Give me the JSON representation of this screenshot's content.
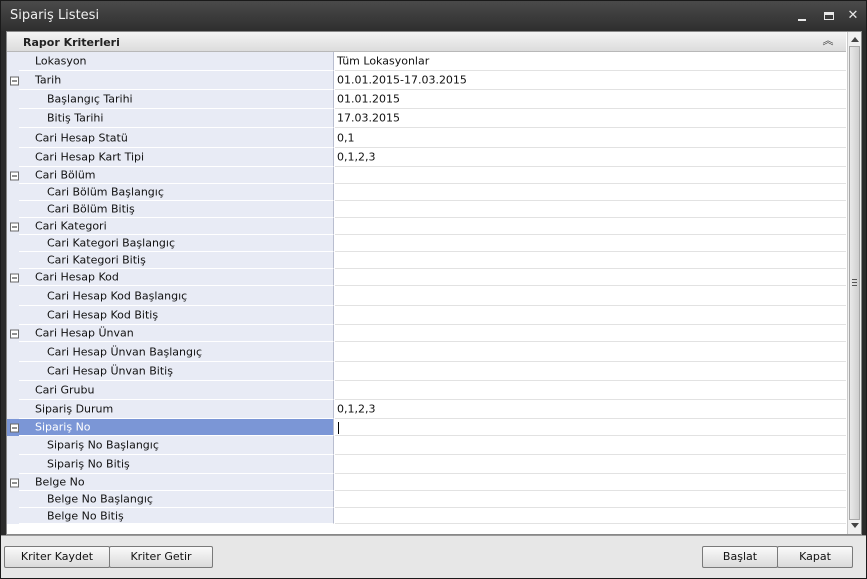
{
  "window": {
    "title": "Sipariş Listesi"
  },
  "group": {
    "title": "Rapor Kriterleri"
  },
  "rows": [
    {
      "name": "Lokasyon",
      "value": "Tüm Lokasyonlar",
      "level": 0,
      "expander": false
    },
    {
      "name": "Tarih",
      "value": "01.01.2015-17.03.2015",
      "level": 0,
      "expander": true
    },
    {
      "name": "Başlangıç Tarihi",
      "value": "01.01.2015",
      "level": 1,
      "expander": false
    },
    {
      "name": "Bitiş Tarihi",
      "value": "17.03.2015",
      "level": 1,
      "expander": false
    },
    {
      "name": "Cari Hesap Statü",
      "value": "0,1",
      "level": 0,
      "expander": false
    },
    {
      "name": "Cari Hesap Kart Tipi",
      "value": "0,1,2,3",
      "level": 0,
      "expander": false
    },
    {
      "name": "Cari Bölüm",
      "value": "",
      "level": 0,
      "expander": true
    },
    {
      "name": "Cari Bölüm Başlangıç",
      "value": "",
      "level": 1,
      "expander": false
    },
    {
      "name": "Cari Bölüm Bitiş",
      "value": "",
      "level": 1,
      "expander": false
    },
    {
      "name": "Cari Kategori",
      "value": "",
      "level": 0,
      "expander": true
    },
    {
      "name": "Cari Kategori Başlangıç",
      "value": "",
      "level": 1,
      "expander": false
    },
    {
      "name": "Cari Kategori Bitiş",
      "value": "",
      "level": 1,
      "expander": false
    },
    {
      "name": "Cari Hesap Kod",
      "value": "",
      "level": 0,
      "expander": true
    },
    {
      "name": "Cari Hesap Kod Başlangıç",
      "value": "",
      "level": 1,
      "expander": false
    },
    {
      "name": "Cari Hesap Kod Bitiş",
      "value": "",
      "level": 1,
      "expander": false
    },
    {
      "name": "Cari Hesap Ünvan",
      "value": "",
      "level": 0,
      "expander": true
    },
    {
      "name": "Cari Hesap Ünvan Başlangıç",
      "value": "",
      "level": 1,
      "expander": false
    },
    {
      "name": "Cari Hesap Ünvan Bitiş",
      "value": "",
      "level": 1,
      "expander": false
    },
    {
      "name": "Cari Grubu",
      "value": "",
      "level": 0,
      "expander": false
    },
    {
      "name": "Sipariş Durum",
      "value": "0,1,2,3",
      "level": 0,
      "expander": false
    },
    {
      "name": "Sipariş No",
      "value": "",
      "level": 0,
      "expander": true,
      "selected": true
    },
    {
      "name": "Sipariş No Başlangıç",
      "value": "",
      "level": 1,
      "expander": false
    },
    {
      "name": "Sipariş No Bitiş",
      "value": "",
      "level": 1,
      "expander": false
    },
    {
      "name": "Belge No",
      "value": "",
      "level": 0,
      "expander": true
    },
    {
      "name": "Belge No Başlangıç",
      "value": "",
      "level": 1,
      "expander": false
    },
    {
      "name": "Belge No Bitiş",
      "value": "",
      "level": 1,
      "expander": false
    }
  ],
  "buttons": {
    "save_criteria": "Kriter Kaydet",
    "load_criteria": "Kriter Getir",
    "start": "Başlat",
    "close": "Kapat"
  },
  "colors": {
    "selected_row": "#7b96d6",
    "name_column": "#e8ebf5"
  }
}
